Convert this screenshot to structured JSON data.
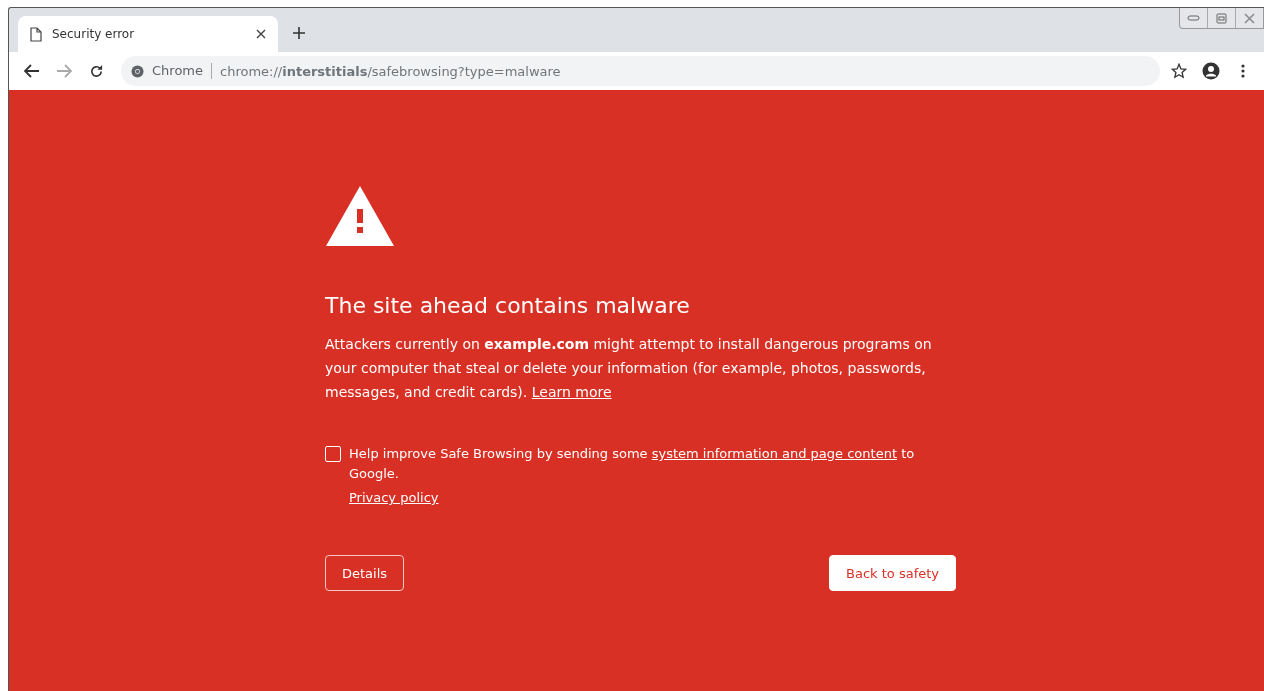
{
  "tab": {
    "title": "Security error",
    "selected": true
  },
  "toolbar": {
    "origin_label": "Chrome",
    "url": "chrome://**interstitials**/safebrowsing?type=malware",
    "forward_disabled": true
  },
  "page": {
    "heading": "The site ahead contains malware",
    "paragraph": "Attackers currently on **example.com** might attempt to install dangerous programs on your computer that steal or delete your information (for example, photos, passwords, messages, and credit cards).",
    "learn_more": "Learn more",
    "opt_in": {
      "checked": false,
      "before": "Help improve Safe Browsing by sending some",
      "link": "system information and page content",
      "after": "to Google."
    },
    "privacy_link": "Privacy policy",
    "buttons": [
      {
        "label": "Details",
        "kind": "secondary"
      },
      {
        "label": "Back to safety",
        "kind": "primary"
      }
    ]
  }
}
